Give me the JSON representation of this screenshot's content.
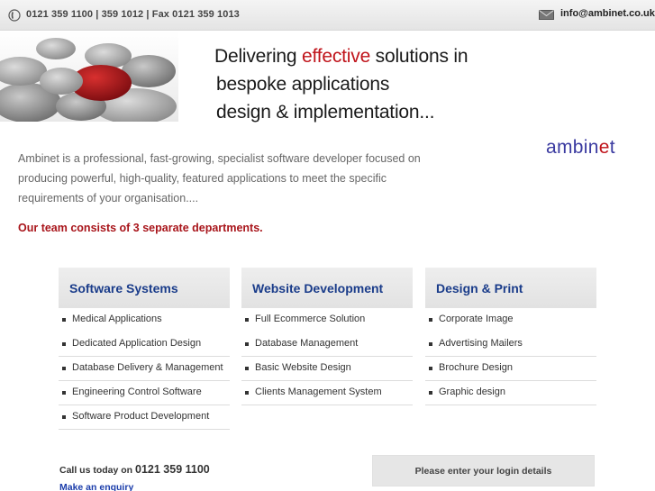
{
  "topbar": {
    "phone": "0121 359 1100 | 359 1012 | Fax 0121 359 1013",
    "email": "info@ambinet.co.uk"
  },
  "hero": {
    "headline_pre": "Delivering ",
    "headline_accent": "effective",
    "headline_post": " solutions in",
    "headline_line2": "bespoke applications",
    "headline_line3": "design & implementation..."
  },
  "intro": {
    "text": "Ambinet is a professional, fast-growing, specialist software developer focused on producing powerful, high-quality, featured applications to meet the specific requirements of your organisation....",
    "team": "Our team consists of 3 separate departments."
  },
  "logo": {
    "main": "ambin",
    "accent": "e",
    "tail": "t"
  },
  "departments": [
    {
      "title": "Software Systems",
      "items": [
        "Medical Applications",
        "Dedicated Application Design",
        "Database Delivery & Management",
        "Engineering Control Software",
        "Software Product Development"
      ]
    },
    {
      "title": "Website Development",
      "items": [
        "Full Ecommerce Solution",
        "Database Management",
        "Basic Website Design",
        "Clients Management System"
      ]
    },
    {
      "title": "Design & Print",
      "items": [
        "Corporate Image",
        "Advertising Mailers",
        "Brochure Design",
        "Graphic design"
      ]
    }
  ],
  "footer": {
    "callus_label": "Call us today on ",
    "callus_number": "0121 359 1100",
    "enquiry": "Make an enquiry",
    "login": "Please enter your login details"
  },
  "colors": {
    "accent_red": "#c0141b",
    "title_blue": "#1a3c8a",
    "link_blue": "#1a3caa"
  }
}
